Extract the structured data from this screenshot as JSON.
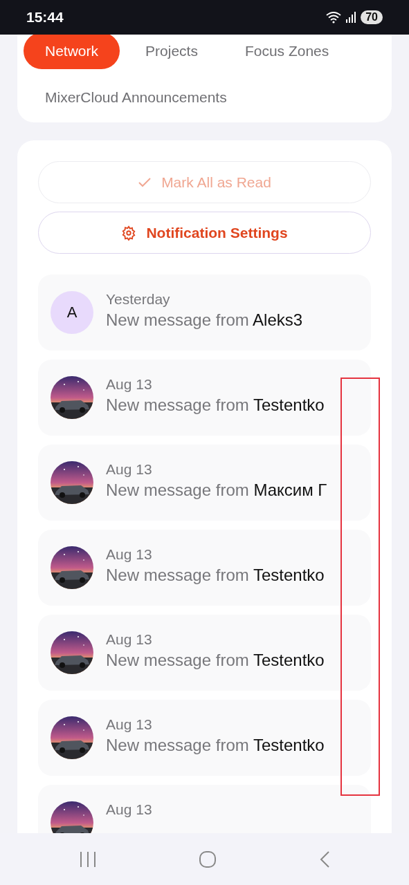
{
  "status_bar": {
    "time": "15:44",
    "battery": "70"
  },
  "tabs": [
    {
      "label": "Network",
      "selected": true
    },
    {
      "label": "Projects",
      "selected": false
    },
    {
      "label": "Focus Zones",
      "selected": false
    },
    {
      "label": "MixerCloud Announcements",
      "selected": false
    }
  ],
  "actions": [
    {
      "kind": "mark_read",
      "label": "Mark All as Read",
      "disabled": true
    },
    {
      "kind": "settings",
      "label": "Notification Settings",
      "disabled": false
    }
  ],
  "notifications": [
    {
      "avatar": {
        "kind": "letter",
        "letter": "A",
        "color": "#e8dafc"
      },
      "date": "Yesterday",
      "prefix": "New message from ",
      "sender": "Aleks3"
    },
    {
      "date": "Aug 13",
      "prefix": "New message from ",
      "sender": "Testentko"
    },
    {
      "date": "Aug 13",
      "prefix": "New message from ",
      "sender": "Максим Г"
    },
    {
      "date": "Aug 13",
      "prefix": "New message from ",
      "sender": "Testentko"
    },
    {
      "date": "Aug 13",
      "prefix": "New message from ",
      "sender": "Testentko"
    },
    {
      "date": "Aug 13",
      "prefix": "New message from ",
      "sender": "Testentko"
    },
    {
      "date": "Aug 13"
    }
  ]
}
